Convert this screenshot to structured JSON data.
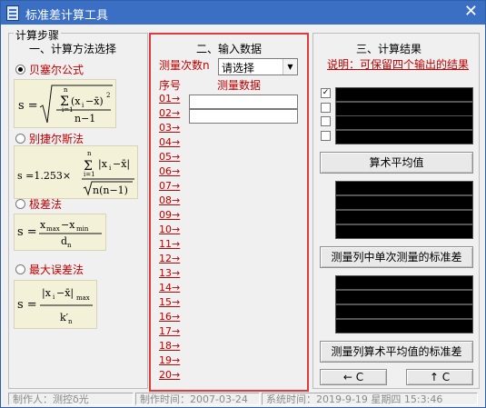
{
  "window": {
    "title": "标准差计算工具",
    "icon": "app-icon",
    "close": "✕"
  },
  "steps_label": "计算步骤",
  "section1": {
    "title": "一、计算方法选择",
    "methods": [
      {
        "label": "贝塞尔公式",
        "selected": true
      },
      {
        "label": "别捷尔斯法",
        "selected": false
      },
      {
        "label": "极差法",
        "selected": false
      },
      {
        "label": "最大误差法",
        "selected": false
      }
    ]
  },
  "section2": {
    "title": "二、输入数据",
    "count_label": "测量次数n",
    "count_value": "请选择",
    "col_index": "序号",
    "col_data": "测量数据",
    "rows": [
      "01→",
      "02→",
      "03→",
      "04→",
      "05→",
      "06→",
      "07→",
      "08→",
      "09→",
      "10→",
      "11→",
      "12→",
      "13→",
      "14→",
      "15→",
      "16→",
      "17→",
      "18→",
      "19→",
      "20→"
    ]
  },
  "section3": {
    "title": "三、计算结果",
    "note": "说明：可保留四个输出的结果",
    "checks": [
      true,
      false,
      false,
      false
    ],
    "btn_mean": "算术平均值",
    "btn_single_std": "测量列中单次测量的标准差",
    "btn_mean_std": "测量列算术平均值的标准差",
    "btn_back": "← C",
    "btn_up": "↑ C"
  },
  "statusbar": {
    "author": "制作人：测控δ光",
    "made": "制作时间：2007-03-24",
    "sys": "系统时间：2019-9-19   星期四   15:3:46"
  },
  "colors": {
    "title_bar": "#3a6fc4",
    "accent_red": "#c00000",
    "frame_red": "#e03a3a",
    "output": "#000000",
    "formula_bg": "#f4f1d9"
  }
}
